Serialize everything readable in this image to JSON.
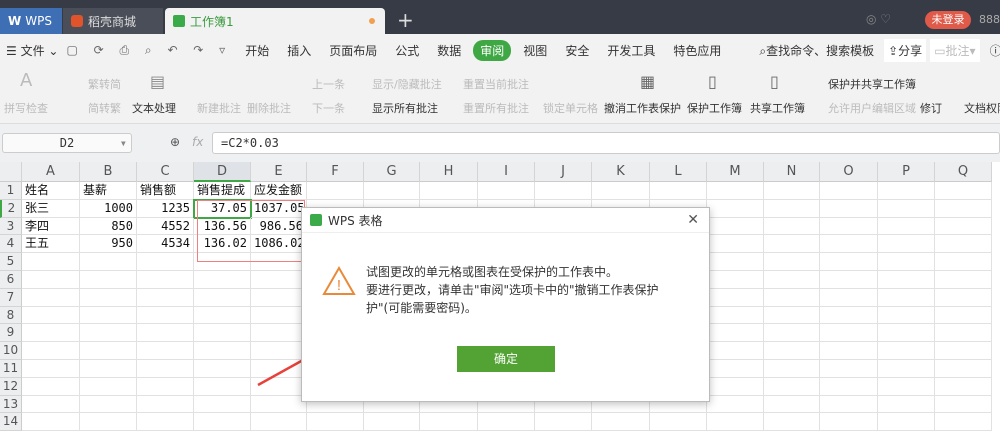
{
  "tabs": {
    "wps": "WPS",
    "store": "稻壳商城",
    "workbook": "工作簿1",
    "login": "未登录",
    "extra": "888"
  },
  "menu": {
    "file": "文件",
    "items": [
      "开始",
      "插入",
      "页面布局",
      "公式",
      "数据",
      "审阅",
      "视图",
      "安全",
      "开发工具",
      "特色应用"
    ],
    "active": "审阅",
    "search": "查找命令、搜索模板",
    "share": "分享",
    "comment": "批注"
  },
  "ribbon": {
    "spell": "拼写检查",
    "trad": "繁转简",
    "simp": "简转繁",
    "text": "文本处理",
    "new_comment": "新建批注",
    "del_comment": "删除批注",
    "prev": "上一条",
    "next": "下一条",
    "showhide": "显示/隐藏批注",
    "showall": "显示所有批注",
    "reset_cur": "重置当前批注",
    "reset_all": "重置所有批注",
    "lock": "锁定单元格",
    "unprotect": "撤消工作表保护",
    "protect_wb": "保护工作簿",
    "share_wb": "共享工作簿",
    "protect_share": "保护并共享工作簿",
    "allow_edit": "允许用户编辑区域",
    "revise": "修订",
    "doc_perm": "文档权限"
  },
  "formula": {
    "cell_ref": "D2",
    "fx": "fx",
    "value": "=C2*0.03"
  },
  "columns": [
    "A",
    "B",
    "C",
    "D",
    "E",
    "F",
    "G",
    "H",
    "I",
    "J",
    "K",
    "L",
    "M",
    "N",
    "O",
    "P",
    "Q"
  ],
  "rows": [
    "1",
    "2",
    "3",
    "4",
    "5",
    "6",
    "7",
    "8",
    "9",
    "10",
    "11",
    "12",
    "13",
    "14"
  ],
  "table": [
    [
      "姓名",
      "基薪",
      "销售额",
      "销售提成",
      "应发金额"
    ],
    [
      "张三",
      "1000",
      "1235",
      "37.05",
      "1037.05"
    ],
    [
      "李四",
      "850",
      "4552",
      "136.56",
      "986.56"
    ],
    [
      "王五",
      "950",
      "4534",
      "136.02",
      "1086.02"
    ]
  ],
  "dialog": {
    "title": "WPS 表格",
    "line1": "试图更改的单元格或图表在受保护的工作表中。",
    "line2": "要进行更改，请单击\"审阅\"选项卡中的\"撤销工作表保护",
    "line3": "护\"(可能需要密码)。",
    "ok": "确定"
  },
  "colors": {
    "green": "#4caf50",
    "ok": "#52a334",
    "red": "#e8403a"
  }
}
